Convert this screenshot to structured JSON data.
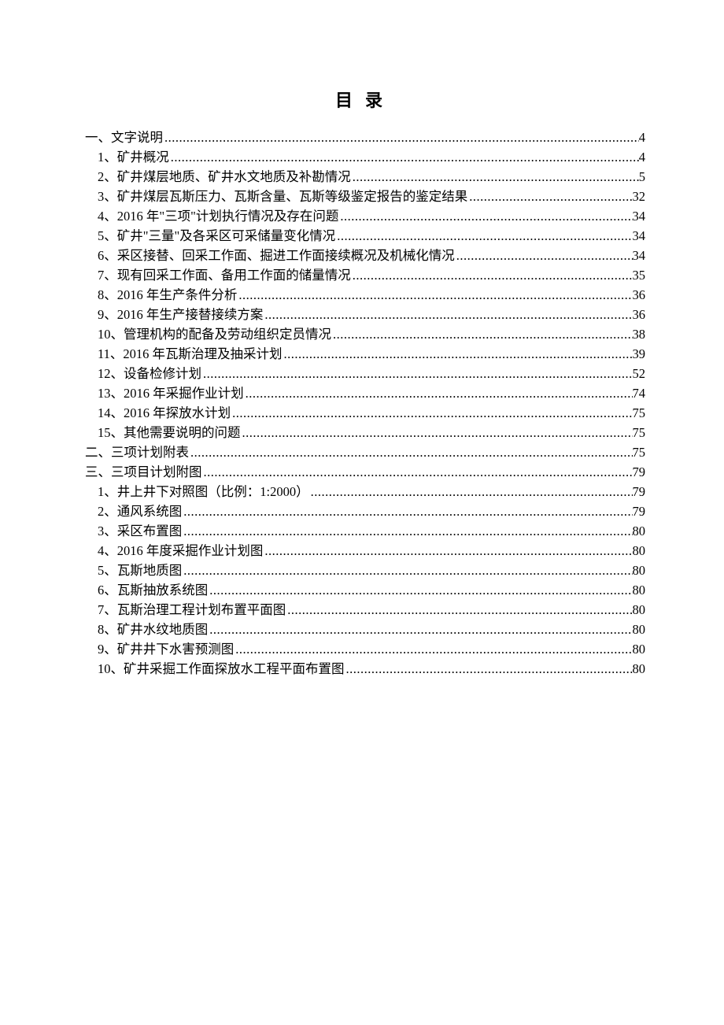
{
  "title": "目录",
  "toc": [
    {
      "level": 0,
      "label": "一、文字说明",
      "page": "4"
    },
    {
      "level": 1,
      "label": "1、矿井概况",
      "page": "4"
    },
    {
      "level": 1,
      "label": "2、矿井煤层地质、矿井水文地质及补勘情况",
      "page": "5"
    },
    {
      "level": 1,
      "label": "3、矿井煤层瓦斯压力、瓦斯含量、瓦斯等级鉴定报告的鉴定结果",
      "page": "32"
    },
    {
      "level": 1,
      "label": "4、2016 年\"三项\"计划执行情况及存在问题",
      "page": "34"
    },
    {
      "level": 1,
      "label": "5、矿井\"三量\"及各采区可采储量变化情况",
      "page": "34"
    },
    {
      "level": 1,
      "label": "6、采区接替、回采工作面、掘进工作面接续概况及机械化情况",
      "page": "34"
    },
    {
      "level": 1,
      "label": "7、现有回采工作面、备用工作面的储量情况",
      "page": "35"
    },
    {
      "level": 1,
      "label": "8、2016 年生产条件分析",
      "page": "36"
    },
    {
      "level": 1,
      "label": "9、2016 年生产接替接续方案",
      "page": "36"
    },
    {
      "level": 1,
      "label": "10、管理机构的配备及劳动组织定员情况",
      "page": "38"
    },
    {
      "level": 1,
      "label": "11、2016 年瓦斯治理及抽采计划",
      "page": "39"
    },
    {
      "level": 1,
      "label": "12、设备检修计划",
      "page": "52"
    },
    {
      "level": 1,
      "label": "13、2016 年采掘作业计划",
      "page": "74"
    },
    {
      "level": 1,
      "label": "14、2016 年探放水计划",
      "page": "75"
    },
    {
      "level": 1,
      "label": "15、其他需要说明的问题",
      "page": "75"
    },
    {
      "level": 0,
      "label": "二、三项计划附表",
      "page": "75"
    },
    {
      "level": 0,
      "label": "三、三项目计划附图",
      "page": "79"
    },
    {
      "level": 1,
      "label": "1、井上井下对照图（比例：1:2000）",
      "page": "79"
    },
    {
      "level": 1,
      "label": "2、通风系统图",
      "page": "79"
    },
    {
      "level": 1,
      "label": "3、采区布置图",
      "page": "80"
    },
    {
      "level": 1,
      "label": "4、2016 年度采掘作业计划图",
      "page": "80"
    },
    {
      "level": 1,
      "label": "5、瓦斯地质图",
      "page": "80"
    },
    {
      "level": 1,
      "label": "6、瓦斯抽放系统图",
      "page": "80"
    },
    {
      "level": 1,
      "label": "7、瓦斯治理工程计划布置平面图",
      "page": "80"
    },
    {
      "level": 1,
      "label": "8、矿井水纹地质图",
      "page": "80"
    },
    {
      "level": 1,
      "label": "9、矿井井下水害预测图",
      "page": "80"
    },
    {
      "level": 1,
      "label": "10、矿井采掘工作面探放水工程平面布置图",
      "page": "80"
    }
  ]
}
